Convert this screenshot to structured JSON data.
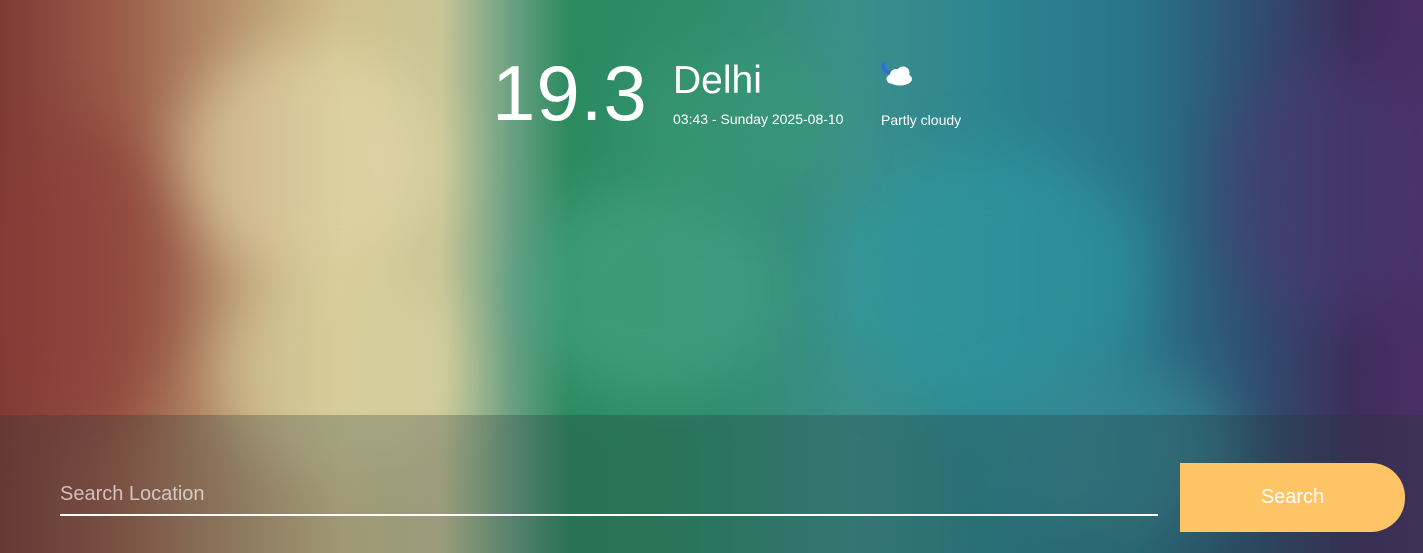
{
  "weather": {
    "temperature": "19.3",
    "city": "Delhi",
    "datetime": "03:43 - Sunday 2025-08-10",
    "condition": "Partly cloudy",
    "condition_icon": "partly-cloudy-night-icon"
  },
  "search": {
    "placeholder": "Search Location",
    "value": "",
    "button_label": "Search"
  },
  "colors": {
    "accent": "#ffc466",
    "text": "#ffffff"
  }
}
